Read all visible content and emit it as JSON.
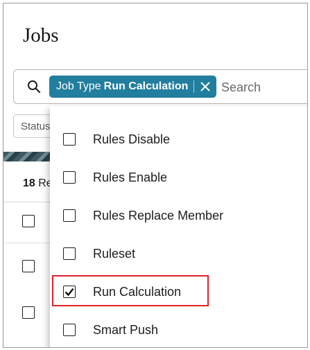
{
  "page": {
    "title": "Jobs"
  },
  "search": {
    "chip": {
      "label": "Job Type",
      "value": "Run Calculation"
    },
    "placeholder": "Search"
  },
  "filters": {
    "status_label": "Status"
  },
  "results": {
    "count": "18",
    "suffix": "Re"
  },
  "dropdown": {
    "options": [
      {
        "label": "Rules Disable",
        "checked": false
      },
      {
        "label": "Rules Enable",
        "checked": false
      },
      {
        "label": "Rules Replace Member",
        "checked": false
      },
      {
        "label": "Ruleset",
        "checked": false
      },
      {
        "label": "Run Calculation",
        "checked": true
      },
      {
        "label": "Smart Push",
        "checked": false
      }
    ]
  },
  "colors": {
    "chip": "#227e9e",
    "highlight": "#e0202b"
  },
  "icons": {
    "search": "search-icon",
    "clear": "close-icon",
    "check": "checkmark-icon"
  }
}
